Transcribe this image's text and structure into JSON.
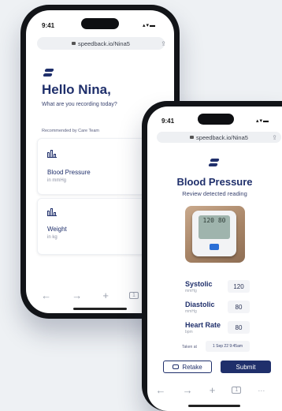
{
  "phone_back": {
    "time": "9:41",
    "url": "speedback.io/Nina5",
    "greeting": "Hello Nina,",
    "subtitle": "What are you recording today?",
    "section_label": "Recommended by Care Team",
    "cards": [
      {
        "title": "Blood Pressure",
        "unit": "in mmHg",
        "icon": "bar-chart-icon"
      },
      {
        "title": "Weight",
        "unit": "in kg",
        "icon": "bar-chart-icon"
      }
    ],
    "nav": [
      "←",
      "→",
      "+",
      "1"
    ]
  },
  "phone_front": {
    "time": "9:41",
    "url": "speedback.io/Nina5",
    "title": "Blood Pressure",
    "subtitle": "Review detected reading",
    "device_display": "120 80",
    "fields": [
      {
        "label": "Systolic",
        "unit": "mmHg",
        "value": "120"
      },
      {
        "label": "Diastolic",
        "unit": "mmHg",
        "value": "80"
      },
      {
        "label": "Heart Rate",
        "unit": "bpm",
        "value": "80"
      }
    ],
    "taken_label": "Taken at",
    "taken_value": "1 Sep 22 9:45am",
    "retake_label": "Retake",
    "submit_label": "Submit",
    "nav": [
      "←",
      "→",
      "+",
      "1",
      "···"
    ]
  },
  "colors": {
    "brand": "#1f2f6b",
    "background": "#eef1f4"
  }
}
